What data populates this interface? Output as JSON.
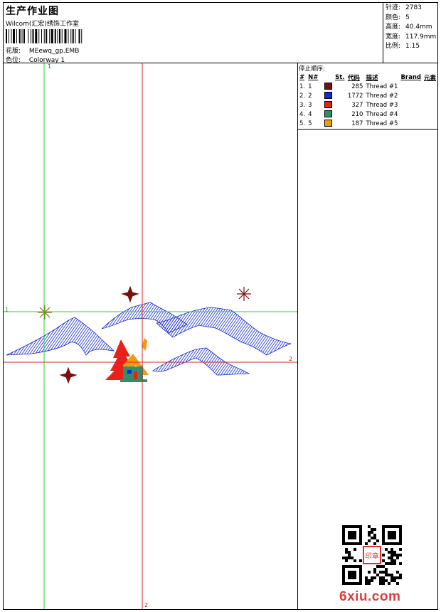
{
  "header": {
    "title": "生产作业图",
    "company": "Wilcom(汇宏)绣饰工作室",
    "design_label": "花版:",
    "design_value": "MEewq_gp.EMB",
    "colorway_label": "色位:",
    "colorway_value": "Colorway 1"
  },
  "stats": [
    {
      "label": "针迹:",
      "value": "2783"
    },
    {
      "label": "颜色:",
      "value": "5"
    },
    {
      "label": "高度:",
      "value": "40.4mm"
    },
    {
      "label": "宽度:",
      "value": "117.9mm"
    },
    {
      "label": "比例:",
      "value": "1.15"
    }
  ],
  "stop_sequence": {
    "caption": "停止顺序:",
    "headers": [
      "#",
      "N#",
      "",
      "St.",
      "代码",
      "描述",
      "Brand",
      "元素"
    ],
    "rows": [
      {
        "idx": "1.",
        "n": "1",
        "color": "#7a0f0f",
        "code": "285",
        "desc": "Thread #1"
      },
      {
        "idx": "2.",
        "n": "2",
        "color": "#1428d9",
        "code": "1772",
        "desc": "Thread #2"
      },
      {
        "idx": "3.",
        "n": "3",
        "color": "#e8211b",
        "code": "327",
        "desc": "Thread #3"
      },
      {
        "idx": "4.",
        "n": "4",
        "color": "#2e8f6a",
        "code": "210",
        "desc": "Thread #4"
      },
      {
        "idx": "5.",
        "n": "5",
        "color": "#f29a12",
        "code": "187",
        "desc": "Thread #5"
      }
    ]
  },
  "guides": {
    "green_v_label": "1",
    "green_h_label": "1",
    "red_h_label": "2",
    "red_v_label": "2",
    "green_color": "#33cc33",
    "red_color": "#e02020"
  },
  "watermark": {
    "site": "6xiu.com",
    "stamp_text": "印章"
  }
}
